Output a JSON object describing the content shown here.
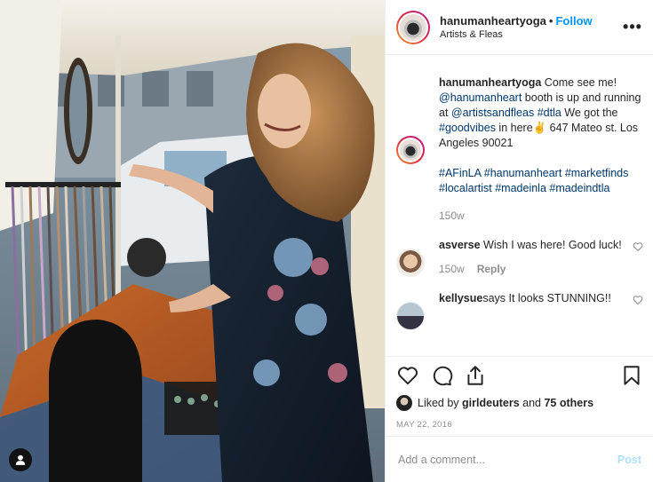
{
  "post": {
    "username": "hanumanheartyoga",
    "dot": "•",
    "follow_label": "Follow",
    "location": "Artists & Fleas"
  },
  "caption": {
    "username": "hanumanheartyoga",
    "t1": " Come see me! ",
    "mention1": "@hanumanheart",
    "t2": " booth is up and running at ",
    "mention2": "@artistsandfleas",
    "t3": " ",
    "tag_dtla": "#dtla",
    "t4": " We got the ",
    "tag_goodvibes": "#goodvibes",
    "t5": " in here✌️ 647 Mateo st. Los Angeles 90021",
    "tags_line": [
      "#AFinLA",
      "#hanumanheart",
      "#marketfinds",
      "#localartist",
      "#madeinla",
      "#madeindtla"
    ],
    "age": "150w"
  },
  "comments": [
    {
      "username": "asverse",
      "text": " Wish I was here! Good luck!",
      "age": "150w",
      "reply_label": "Reply"
    },
    {
      "username": "kellysue",
      "text": "says It looks STUNNING!!"
    }
  ],
  "actions": {
    "liked_prefix": "Liked by ",
    "liked_user": "girldeuters",
    "liked_and": " and ",
    "liked_others": "75 others",
    "date": "MAY 22, 2016"
  },
  "composer": {
    "placeholder": "Add a comment...",
    "post_label": "Post"
  },
  "colors": {
    "follow": "#0095f6",
    "link": "#00376b",
    "muted": "#8e8e8e",
    "post_disabled": "#b2dffc"
  },
  "icons": [
    "heart-icon",
    "comment-icon",
    "share-icon",
    "bookmark-icon",
    "more-options-icon",
    "user-tag-icon"
  ]
}
